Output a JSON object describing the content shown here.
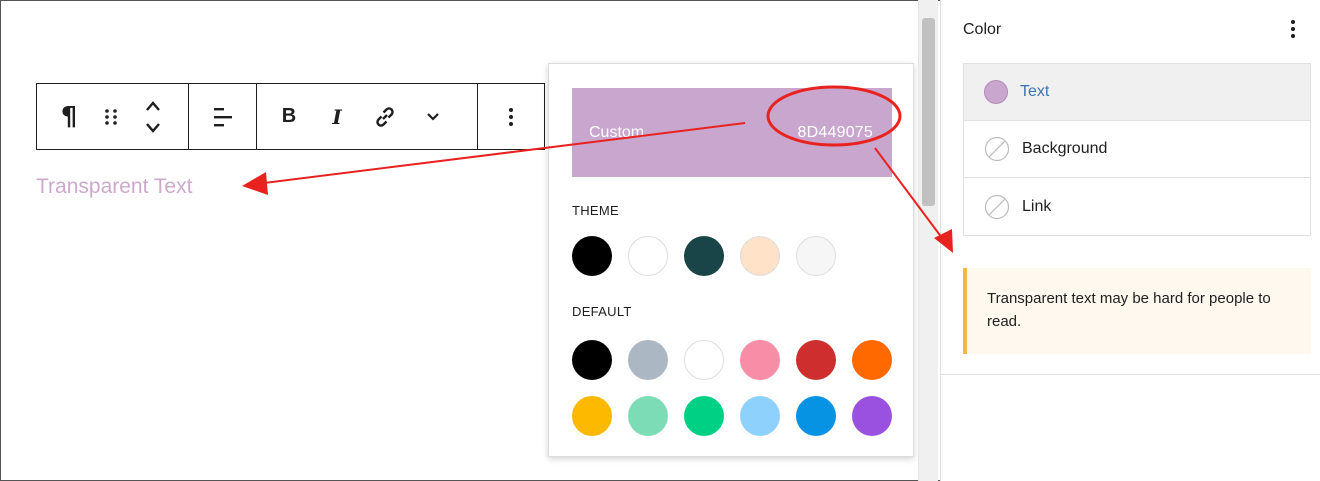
{
  "editor": {
    "block_text": "Transparent Text",
    "toolbar": {
      "paragraph_icon": "¶",
      "bold_label": "B",
      "italic_label": "I"
    }
  },
  "popover": {
    "custom_label": "Custom",
    "custom_hex": "8D449075",
    "custom_color": "#c9a6ce",
    "theme_label": "THEME",
    "default_label": "DEFAULT",
    "theme_colors": [
      "#000000",
      "#ffffff",
      "#1a4548",
      "#ffe2c7",
      "#f6f6f6"
    ],
    "default_colors": [
      [
        "#000000",
        "#abb8c3",
        "#ffffff",
        "#f78da7",
        "#cf2e2e",
        "#ff6900"
      ],
      [
        "#fcb900",
        "#7bdcb5",
        "#00d084",
        "#8ed1fc",
        "#0693e3",
        "#9b51e0"
      ]
    ]
  },
  "sidebar": {
    "title": "Color",
    "items": [
      {
        "label": "Text"
      },
      {
        "label": "Background"
      },
      {
        "label": "Link"
      }
    ],
    "notice": "Transparent text may be hard for people to read."
  },
  "annotation_color": "#e8231f",
  "accent_color": "#3a73b5"
}
